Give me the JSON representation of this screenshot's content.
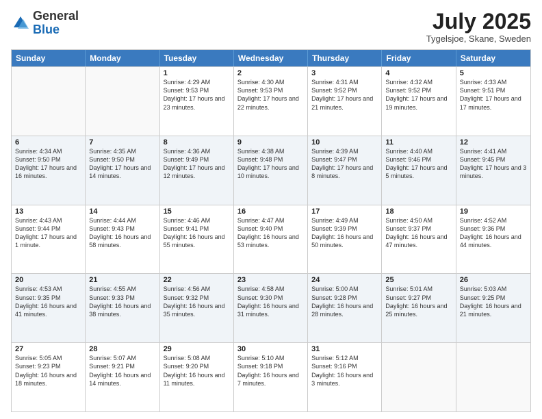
{
  "logo": {
    "general": "General",
    "blue": "Blue"
  },
  "title": {
    "month_year": "July 2025",
    "location": "Tygelsjoe, Skane, Sweden"
  },
  "header_days": [
    "Sunday",
    "Monday",
    "Tuesday",
    "Wednesday",
    "Thursday",
    "Friday",
    "Saturday"
  ],
  "rows": [
    [
      {
        "day": "",
        "detail": ""
      },
      {
        "day": "",
        "detail": ""
      },
      {
        "day": "1",
        "detail": "Sunrise: 4:29 AM\nSunset: 9:53 PM\nDaylight: 17 hours and 23 minutes."
      },
      {
        "day": "2",
        "detail": "Sunrise: 4:30 AM\nSunset: 9:53 PM\nDaylight: 17 hours and 22 minutes."
      },
      {
        "day": "3",
        "detail": "Sunrise: 4:31 AM\nSunset: 9:52 PM\nDaylight: 17 hours and 21 minutes."
      },
      {
        "day": "4",
        "detail": "Sunrise: 4:32 AM\nSunset: 9:52 PM\nDaylight: 17 hours and 19 minutes."
      },
      {
        "day": "5",
        "detail": "Sunrise: 4:33 AM\nSunset: 9:51 PM\nDaylight: 17 hours and 17 minutes."
      }
    ],
    [
      {
        "day": "6",
        "detail": "Sunrise: 4:34 AM\nSunset: 9:50 PM\nDaylight: 17 hours and 16 minutes."
      },
      {
        "day": "7",
        "detail": "Sunrise: 4:35 AM\nSunset: 9:50 PM\nDaylight: 17 hours and 14 minutes."
      },
      {
        "day": "8",
        "detail": "Sunrise: 4:36 AM\nSunset: 9:49 PM\nDaylight: 17 hours and 12 minutes."
      },
      {
        "day": "9",
        "detail": "Sunrise: 4:38 AM\nSunset: 9:48 PM\nDaylight: 17 hours and 10 minutes."
      },
      {
        "day": "10",
        "detail": "Sunrise: 4:39 AM\nSunset: 9:47 PM\nDaylight: 17 hours and 8 minutes."
      },
      {
        "day": "11",
        "detail": "Sunrise: 4:40 AM\nSunset: 9:46 PM\nDaylight: 17 hours and 5 minutes."
      },
      {
        "day": "12",
        "detail": "Sunrise: 4:41 AM\nSunset: 9:45 PM\nDaylight: 17 hours and 3 minutes."
      }
    ],
    [
      {
        "day": "13",
        "detail": "Sunrise: 4:43 AM\nSunset: 9:44 PM\nDaylight: 17 hours and 1 minute."
      },
      {
        "day": "14",
        "detail": "Sunrise: 4:44 AM\nSunset: 9:43 PM\nDaylight: 16 hours and 58 minutes."
      },
      {
        "day": "15",
        "detail": "Sunrise: 4:46 AM\nSunset: 9:41 PM\nDaylight: 16 hours and 55 minutes."
      },
      {
        "day": "16",
        "detail": "Sunrise: 4:47 AM\nSunset: 9:40 PM\nDaylight: 16 hours and 53 minutes."
      },
      {
        "day": "17",
        "detail": "Sunrise: 4:49 AM\nSunset: 9:39 PM\nDaylight: 16 hours and 50 minutes."
      },
      {
        "day": "18",
        "detail": "Sunrise: 4:50 AM\nSunset: 9:37 PM\nDaylight: 16 hours and 47 minutes."
      },
      {
        "day": "19",
        "detail": "Sunrise: 4:52 AM\nSunset: 9:36 PM\nDaylight: 16 hours and 44 minutes."
      }
    ],
    [
      {
        "day": "20",
        "detail": "Sunrise: 4:53 AM\nSunset: 9:35 PM\nDaylight: 16 hours and 41 minutes."
      },
      {
        "day": "21",
        "detail": "Sunrise: 4:55 AM\nSunset: 9:33 PM\nDaylight: 16 hours and 38 minutes."
      },
      {
        "day": "22",
        "detail": "Sunrise: 4:56 AM\nSunset: 9:32 PM\nDaylight: 16 hours and 35 minutes."
      },
      {
        "day": "23",
        "detail": "Sunrise: 4:58 AM\nSunset: 9:30 PM\nDaylight: 16 hours and 31 minutes."
      },
      {
        "day": "24",
        "detail": "Sunrise: 5:00 AM\nSunset: 9:28 PM\nDaylight: 16 hours and 28 minutes."
      },
      {
        "day": "25",
        "detail": "Sunrise: 5:01 AM\nSunset: 9:27 PM\nDaylight: 16 hours and 25 minutes."
      },
      {
        "day": "26",
        "detail": "Sunrise: 5:03 AM\nSunset: 9:25 PM\nDaylight: 16 hours and 21 minutes."
      }
    ],
    [
      {
        "day": "27",
        "detail": "Sunrise: 5:05 AM\nSunset: 9:23 PM\nDaylight: 16 hours and 18 minutes."
      },
      {
        "day": "28",
        "detail": "Sunrise: 5:07 AM\nSunset: 9:21 PM\nDaylight: 16 hours and 14 minutes."
      },
      {
        "day": "29",
        "detail": "Sunrise: 5:08 AM\nSunset: 9:20 PM\nDaylight: 16 hours and 11 minutes."
      },
      {
        "day": "30",
        "detail": "Sunrise: 5:10 AM\nSunset: 9:18 PM\nDaylight: 16 hours and 7 minutes."
      },
      {
        "day": "31",
        "detail": "Sunrise: 5:12 AM\nSunset: 9:16 PM\nDaylight: 16 hours and 3 minutes."
      },
      {
        "day": "",
        "detail": ""
      },
      {
        "day": "",
        "detail": ""
      }
    ]
  ]
}
